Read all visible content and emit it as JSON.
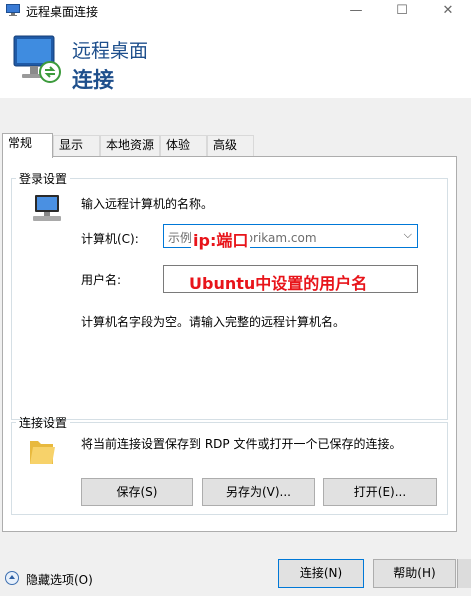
{
  "window": {
    "title": "远程桌面连接",
    "minimize_glyph": "—",
    "maximize_glyph": "☐",
    "close_glyph": "✕"
  },
  "banner": {
    "line1": "远程桌面",
    "line2": "连接"
  },
  "tabs": [
    {
      "label": "常规",
      "active": true
    },
    {
      "label": "显示"
    },
    {
      "label": "本地资源"
    },
    {
      "label": "体验"
    },
    {
      "label": "高级"
    }
  ],
  "login": {
    "legend": "登录设置",
    "prompt": "输入远程计算机的名称。",
    "computer_label": "计算机(C):",
    "computer_placeholder_prefix": "示例",
    "computer_placeholder_suffix": ".fabrikam.com",
    "computer_annotation": "ip:端口",
    "username_label": "用户名:",
    "username_annotation": "Ubuntu中设置的用户名",
    "hint": "计算机名字段为空。请输入完整的远程计算机名。"
  },
  "connection": {
    "legend": "连接设置",
    "description": "将当前连接设置保存到 RDP 文件或打开一个已保存的连接。",
    "save": "保存(S)",
    "save_as": "另存为(V)...",
    "open": "打开(E)..."
  },
  "footer": {
    "hide_options": "隐藏选项(O)",
    "connect": "连接(N)",
    "help": "帮助(H)"
  },
  "colors": {
    "accent": "#0078d7",
    "banner_text": "#1e4f8c",
    "annotation": "#e8141a"
  }
}
